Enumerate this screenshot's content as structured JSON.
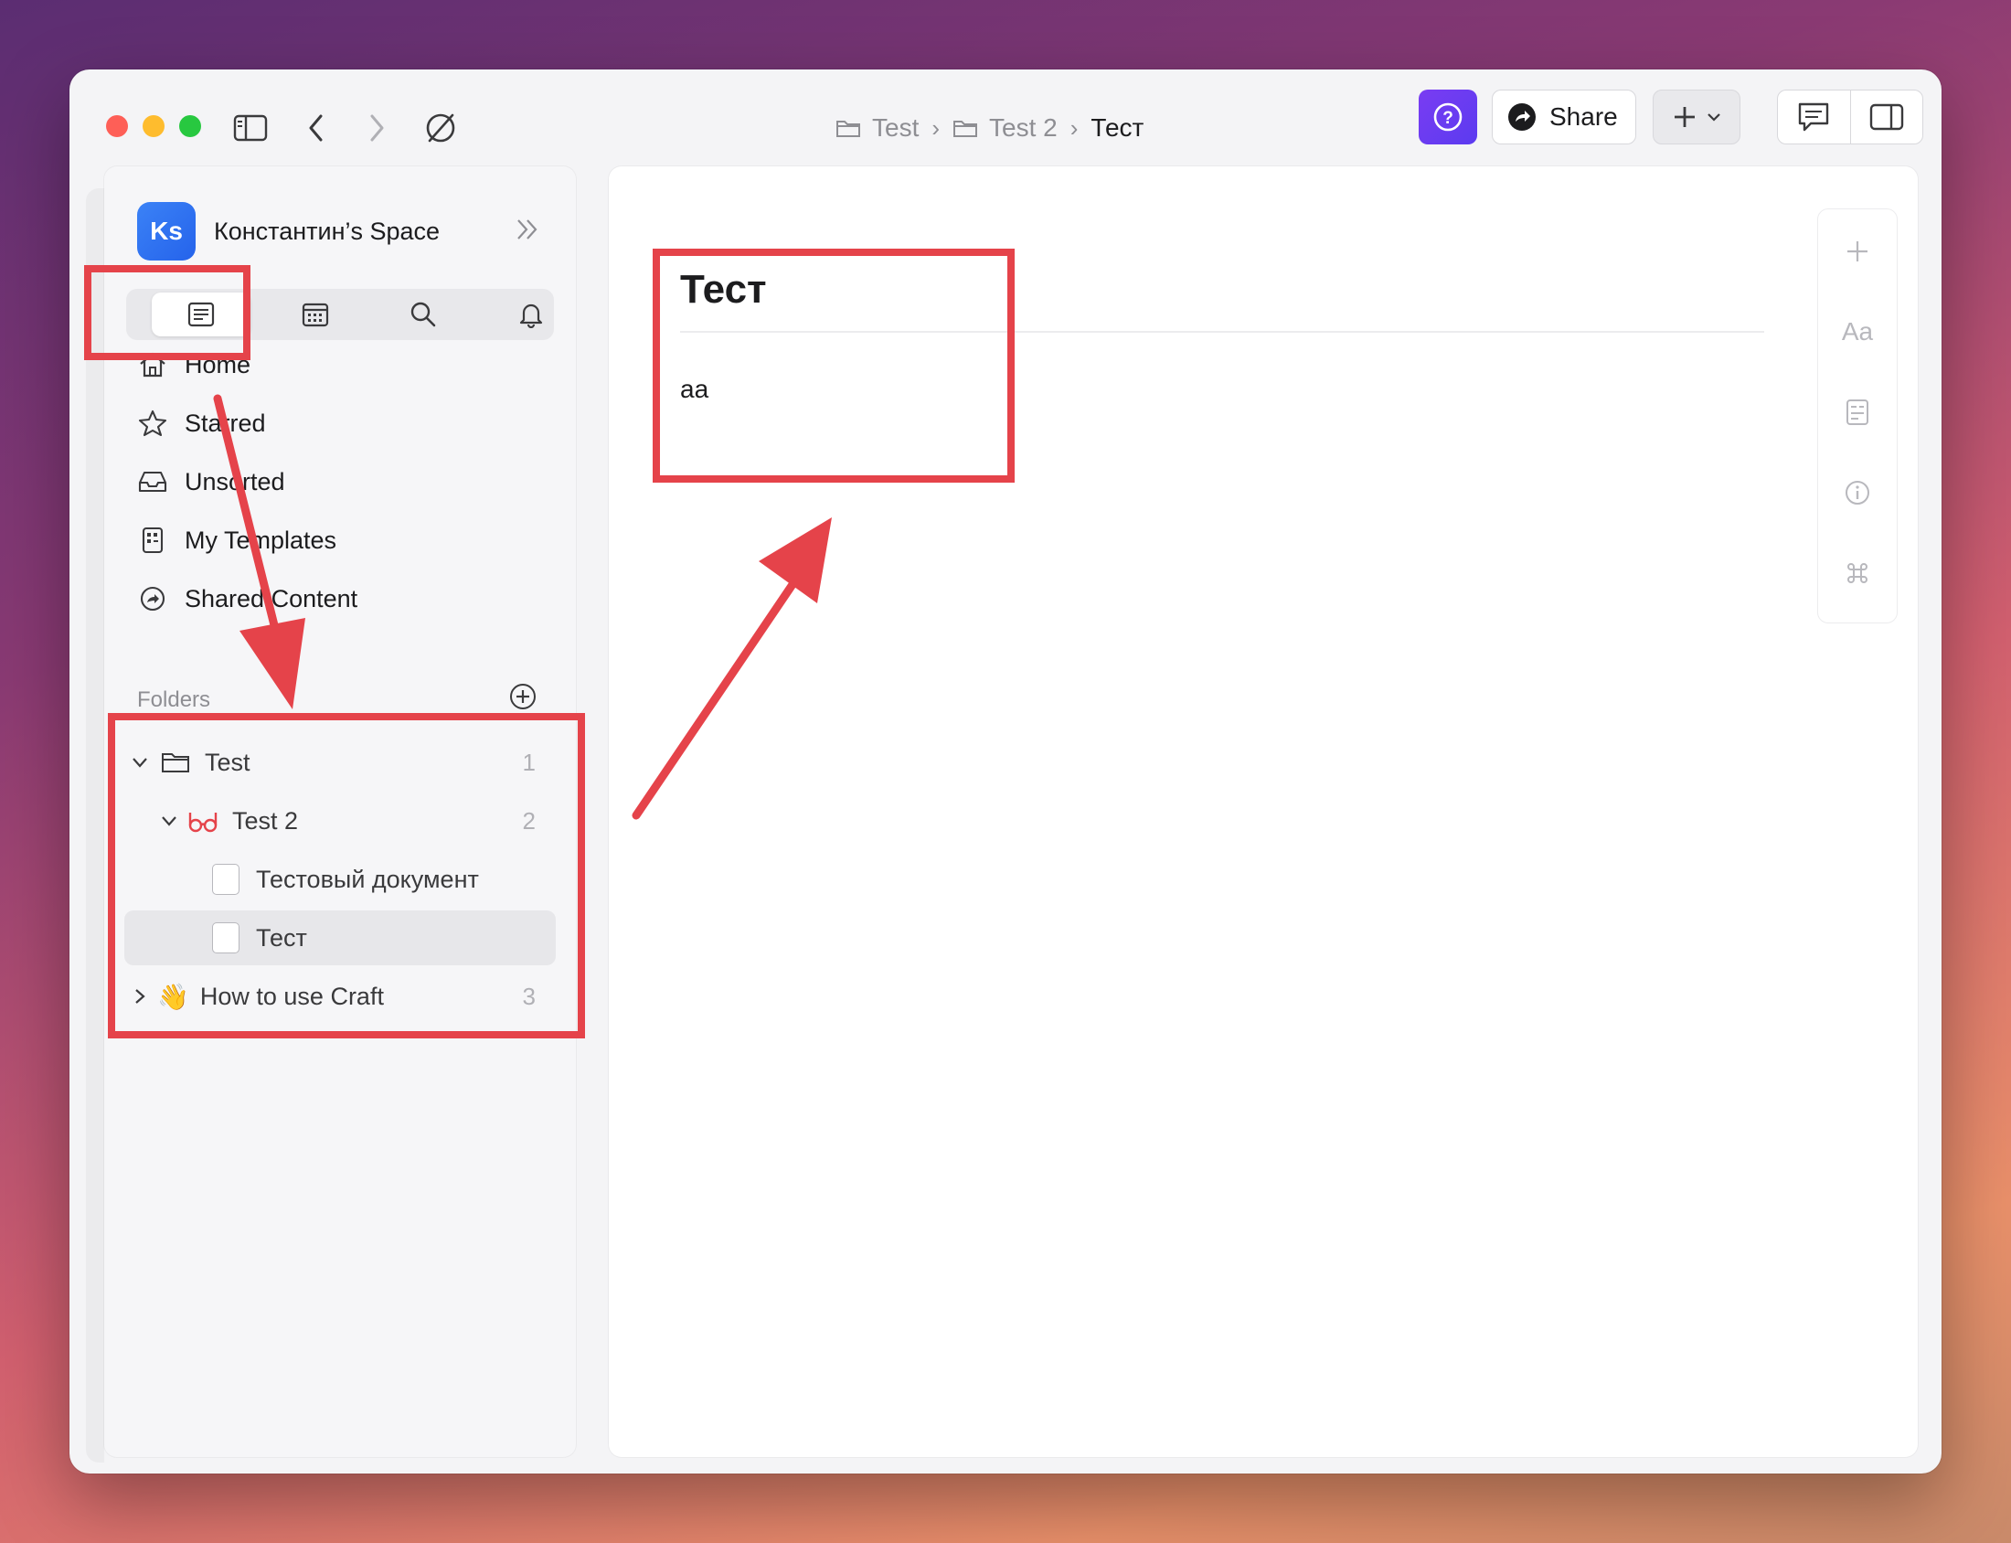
{
  "window": {
    "breadcrumb": [
      {
        "label": "Test",
        "icon": "folder-icon"
      },
      {
        "label": "Test 2",
        "icon": "folder-icon"
      },
      {
        "label": "Тест",
        "icon": ""
      }
    ],
    "share_label": "Share"
  },
  "sidebar": {
    "avatar_initials": "Ks",
    "space_name": "Константин’s Space",
    "tabs": [
      "documents-icon",
      "calendar-icon",
      "search-icon",
      "bell-icon"
    ],
    "nav": [
      {
        "label": "Home",
        "icon": "home-icon"
      },
      {
        "label": "Starred",
        "icon": "star-icon"
      },
      {
        "label": "Unsorted",
        "icon": "inbox-icon"
      },
      {
        "label": "My Templates",
        "icon": "templates-icon"
      },
      {
        "label": "Shared Content",
        "icon": "shared-icon"
      }
    ],
    "folders_label": "Folders",
    "tree": [
      {
        "label": "Test",
        "count": "1"
      },
      {
        "label": "Test 2",
        "count": "2"
      },
      {
        "label": "Тестовый документ",
        "count": ""
      },
      {
        "label": "Тест",
        "count": ""
      },
      {
        "label": "How to use Craft",
        "count": "3",
        "emoji": "👋"
      }
    ]
  },
  "document": {
    "title": "Тест",
    "body": "aa"
  },
  "right_tools": [
    "plus-icon",
    "Aa",
    "document-style-icon",
    "info-icon",
    "command-icon"
  ],
  "colors": {
    "annotation": "#e5434a",
    "accent": "#6a3cf1",
    "avatar": "#2f6ff0"
  }
}
